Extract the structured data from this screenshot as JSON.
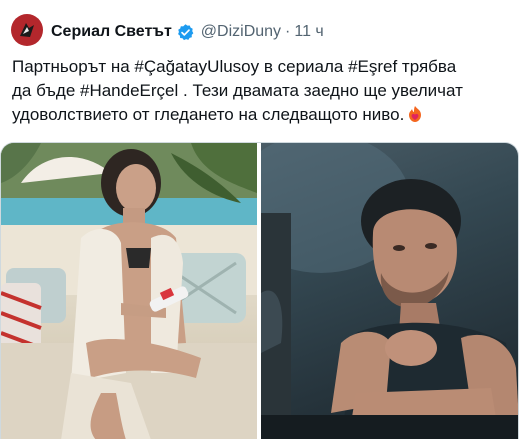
{
  "tweet": {
    "author": {
      "display_name": "Сериал Светът",
      "handle": "@DiziDuny",
      "separator": "·",
      "time": "11 ч",
      "verified_icon": "verified-badge-icon"
    },
    "text_lines": [
      "Партньорът на #ÇağatayUlusoy в сериала #Eşref трябва",
      "да бъде #HandeErçel . Тези двамата заедно ще увеличат",
      "удоволствието от гледането на следващото ниво."
    ],
    "emoji": "fire-heart-emoji",
    "media": {
      "count": 2,
      "left_photo": "woman-on-sofa-photo",
      "right_photo": "man-leaning-photo"
    },
    "colors": {
      "avatar_bg": "#b3272c",
      "verified": "#1d9bf0",
      "text": "#0f1419",
      "secondary": "#536471"
    }
  }
}
